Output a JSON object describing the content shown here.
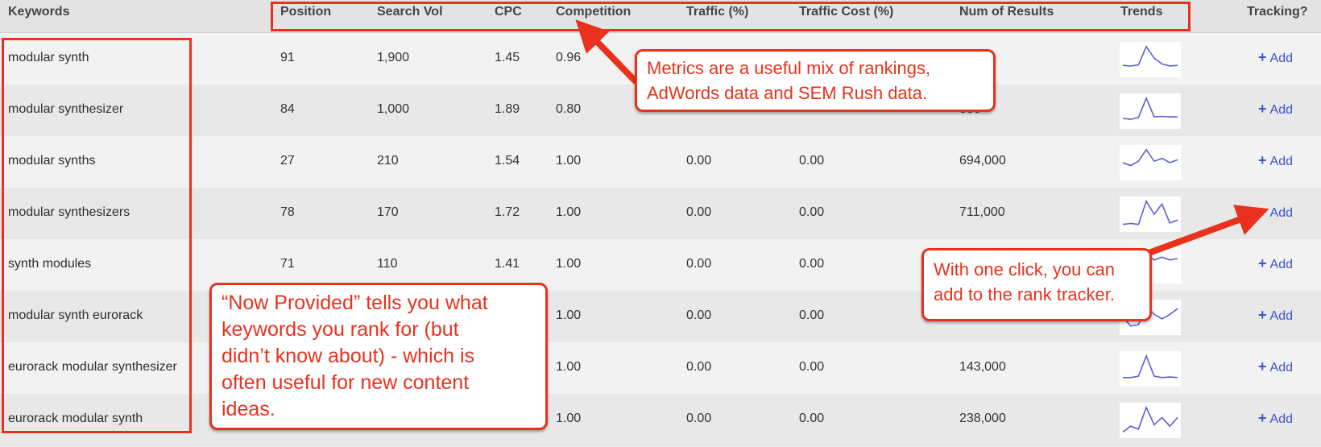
{
  "headers": {
    "keywords": "Keywords",
    "position": "Position",
    "search_vol": "Search Vol",
    "cpc": "CPC",
    "competition": "Competition",
    "traffic": "Traffic (%)",
    "traffic_cost": "Traffic Cost (%)",
    "num_results": "Num of Results",
    "trends": "Trends",
    "tracking": "Tracking?"
  },
  "add_label": "Add",
  "rows": [
    {
      "keyword": "modular synth",
      "position": "91",
      "search_vol": "1,900",
      "cpc": "1.45",
      "competition": "0.96",
      "traffic": "",
      "traffic_cost": "",
      "num_results": "000",
      "trend": [
        0.3,
        0.28,
        0.32,
        0.95,
        0.55,
        0.35,
        0.28,
        0.3
      ]
    },
    {
      "keyword": "modular synthesizer",
      "position": "84",
      "search_vol": "1,000",
      "cpc": "1.89",
      "competition": "0.80",
      "traffic": "",
      "traffic_cost": "",
      "num_results": "000",
      "trend": [
        0.25,
        0.22,
        0.28,
        0.95,
        0.3,
        0.32,
        0.3,
        0.3
      ]
    },
    {
      "keyword": "modular synths",
      "position": "27",
      "search_vol": "210",
      "cpc": "1.54",
      "competition": "1.00",
      "traffic": "0.00",
      "traffic_cost": "0.00",
      "num_results": "694,000",
      "trend": [
        0.5,
        0.4,
        0.55,
        0.95,
        0.55,
        0.65,
        0.5,
        0.6
      ]
    },
    {
      "keyword": "modular synthesizers",
      "position": "78",
      "search_vol": "170",
      "cpc": "1.72",
      "competition": "1.00",
      "traffic": "0.00",
      "traffic_cost": "0.00",
      "num_results": "711,000",
      "trend": [
        0.15,
        0.18,
        0.15,
        0.95,
        0.5,
        0.85,
        0.2,
        0.3
      ]
    },
    {
      "keyword": "synth modules",
      "position": "71",
      "search_vol": "110",
      "cpc": "1.41",
      "competition": "1.00",
      "traffic": "0.00",
      "traffic_cost": "0.00",
      "num_results": "",
      "trend": [
        0.4,
        0.5,
        0.7,
        0.9,
        0.7,
        0.8,
        0.7,
        0.75
      ]
    },
    {
      "keyword": "modular synth eurorack",
      "position": "",
      "search_vol": "",
      "cpc": "",
      "competition": "1.00",
      "traffic": "0.00",
      "traffic_cost": "0.00",
      "num_results": "",
      "trend": [
        0.5,
        0.2,
        0.25,
        0.9,
        0.6,
        0.45,
        0.6,
        0.8
      ]
    },
    {
      "keyword": "eurorack modular synthesizer",
      "position": "",
      "search_vol": "",
      "cpc": "",
      "competition": "1.00",
      "traffic": "0.00",
      "traffic_cost": "0.00",
      "num_results": "143,000",
      "trend": [
        0.2,
        0.2,
        0.25,
        0.95,
        0.25,
        0.2,
        0.22,
        0.2
      ]
    },
    {
      "keyword": "eurorack modular synth",
      "position": "",
      "search_vol": "",
      "cpc": "",
      "competition": "1.00",
      "traffic": "0.00",
      "traffic_cost": "0.00",
      "num_results": "238,000",
      "trend": [
        0.1,
        0.3,
        0.2,
        0.95,
        0.35,
        0.6,
        0.3,
        0.6
      ]
    }
  ],
  "callouts": {
    "metrics": [
      "Metrics are a useful mix of rankings,",
      "AdWords data and SEM Rush data."
    ],
    "tracker": [
      "With one click, you can",
      "add to the rank tracker."
    ],
    "provided": [
      "“Now Provided” tells you what",
      "keywords you rank for (but",
      "didn’t know about) - which is",
      "often useful for new content",
      "ideas."
    ]
  },
  "colors": {
    "annotation": "#e8321e",
    "link": "#3b56c9",
    "sparkline": "#5b5fd9",
    "header_bg": "#e3e3e3"
  }
}
